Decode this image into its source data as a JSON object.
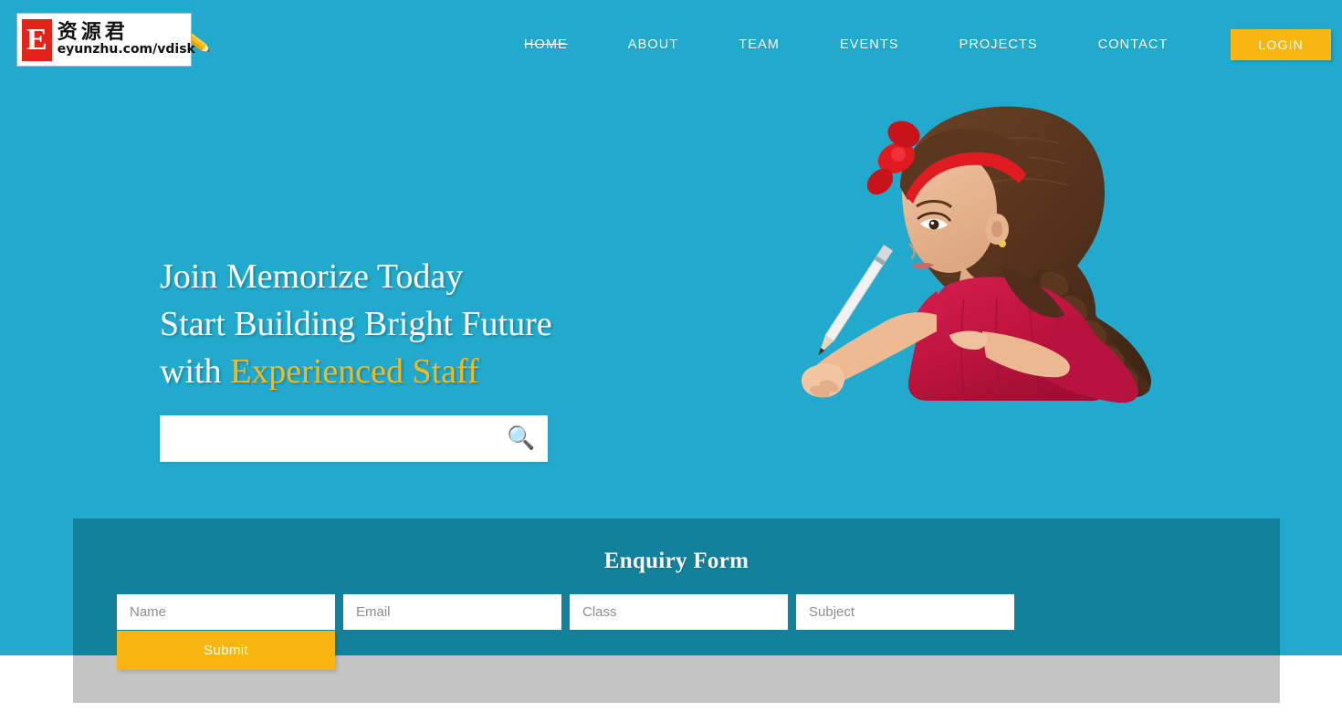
{
  "brand": {
    "name": "Memorize",
    "pencil_icon": "pencil-icon",
    "pencil_glyph": "✏️"
  },
  "watermark": {
    "letter": "E",
    "chinese": "资源君",
    "url": "eyunzhu.com/vdisk"
  },
  "nav": {
    "items": [
      {
        "label": "HOME",
        "active": true
      },
      {
        "label": "ABOUT",
        "active": false
      },
      {
        "label": "TEAM",
        "active": false
      },
      {
        "label": "EVENTS",
        "active": false
      },
      {
        "label": "PROJECTS",
        "active": false
      },
      {
        "label": "CONTACT",
        "active": false
      }
    ],
    "login_label": "LOGIN"
  },
  "hero": {
    "line1": "Join Memorize Today",
    "line2": "Start Building Bright Future",
    "line3_prefix": "with ",
    "line3_accent": "Experienced Staff",
    "search": {
      "value": "",
      "placeholder": "",
      "icon": "search-icon",
      "icon_glyph": "🔍"
    }
  },
  "enquiry": {
    "title": "Enquiry Form",
    "fields": [
      {
        "name": "name",
        "placeholder": "Name",
        "value": ""
      },
      {
        "name": "email",
        "placeholder": "Email",
        "value": ""
      },
      {
        "name": "class",
        "placeholder": "Class",
        "value": ""
      },
      {
        "name": "subject",
        "placeholder": "Subject",
        "value": ""
      }
    ],
    "submit_label": "Submit"
  },
  "colors": {
    "hero_bg": "#21aacd",
    "panel_bg": "#12829c",
    "accent_amber": "#f9b611",
    "heading_accent": "#f5b91c",
    "gray_strip": "#c4c4c4",
    "dress_red": "#c2154b"
  }
}
